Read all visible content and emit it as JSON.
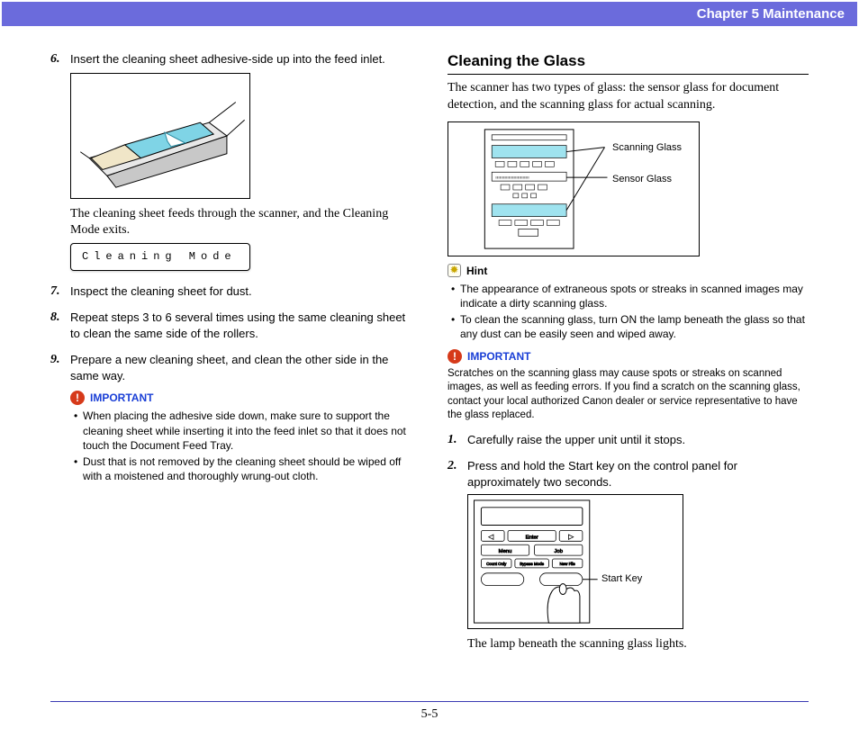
{
  "chapter": {
    "label": "Chapter 5   Maintenance"
  },
  "page_number": "5-5",
  "left": {
    "step6": {
      "num": "6.",
      "text": "Insert the cleaning sheet adhesive-side up into the feed inlet.",
      "caption": "The cleaning sheet feeds through the scanner, and the Cleaning Mode exits."
    },
    "lcd": "Cleaning Mode",
    "step7": {
      "num": "7.",
      "text": "Inspect the cleaning sheet for dust."
    },
    "step8": {
      "num": "8.",
      "text": "Repeat steps 3 to 6 several times using the same cleaning sheet to clean the same side of the rollers."
    },
    "step9": {
      "num": "9.",
      "text": "Prepare a new cleaning sheet, and clean the other side in the same way."
    },
    "important_label": "IMPORTANT",
    "important_bullets": [
      "When placing the adhesive side down, make sure to support the cleaning sheet while inserting it into the feed inlet so that it does not touch the Document Feed Tray.",
      "Dust that is not removed by the cleaning sheet should be wiped off with a moistened and thoroughly wrung-out cloth."
    ]
  },
  "right": {
    "heading": "Cleaning the Glass",
    "intro": "The scanner has two types of glass: the sensor glass for document detection, and the scanning glass for actual scanning.",
    "glass_labels": {
      "scanning": "Scanning Glass",
      "sensor": "Sensor Glass"
    },
    "hint_label": "Hint",
    "hint_bullets": [
      "The appearance of extraneous spots or streaks in scanned images may indicate a dirty scanning glass.",
      "To clean the scanning glass, turn ON the lamp beneath the glass so that any dust can be easily seen and wiped away."
    ],
    "important_label": "IMPORTANT",
    "important_text": "Scratches on the scanning glass may cause spots or streaks on scanned images, as well as feeding errors. If you find a scratch on the scanning glass, contact your local authorized Canon dealer or service representative to have the glass replaced.",
    "step1": {
      "num": "1.",
      "text": "Carefully raise the upper unit until it stops."
    },
    "step2": {
      "num": "2.",
      "text": "Press and hold the Start key on the control panel for approximately two seconds."
    },
    "start_key_label": "Start Key",
    "panel_caption": "The lamp beneath the scanning glass lights.",
    "panel_buttons": {
      "enter": "Enter",
      "menu": "Menu",
      "job": "Job",
      "count": "Count Only",
      "bypass": "Bypass Mode",
      "newfile": "New File"
    }
  }
}
